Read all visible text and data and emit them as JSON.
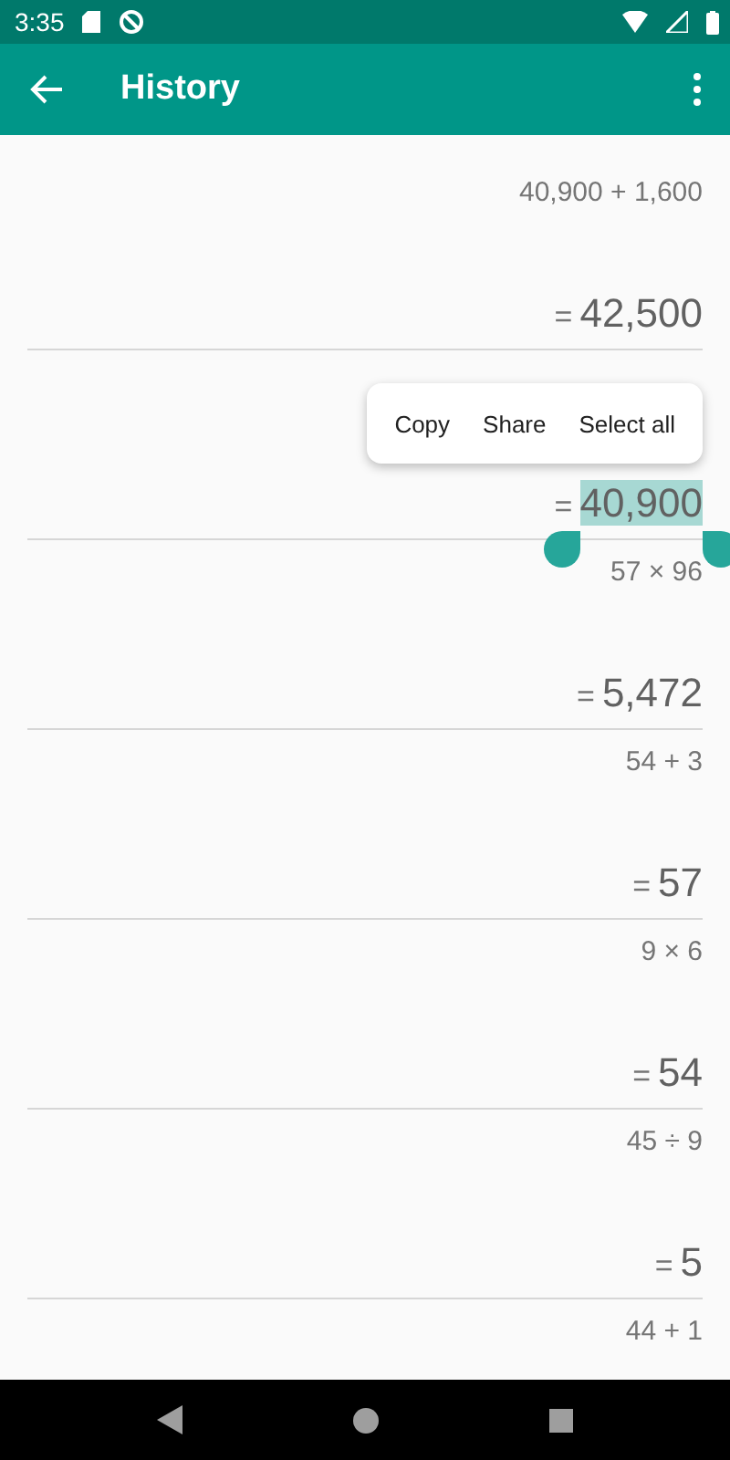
{
  "status_bar": {
    "time": "3:35"
  },
  "app_bar": {
    "title": "History"
  },
  "entries": [
    {
      "expression": "40,900 + 1,600",
      "result": "42,500",
      "selected": false
    },
    {
      "result": "40,900",
      "selected": true
    },
    {
      "expression": "57 × 96",
      "result": "5,472",
      "selected": false
    },
    {
      "expression": "54 + 3",
      "result": "57",
      "selected": false
    },
    {
      "expression": "9 × 6",
      "result": "54",
      "selected": false
    },
    {
      "expression": "45 ÷ 9",
      "result": "5",
      "selected": false
    },
    {
      "expression": "44 + 1"
    }
  ],
  "equals_sign": "=",
  "selection_menu": [
    "Copy",
    "Share",
    "Select all"
  ]
}
